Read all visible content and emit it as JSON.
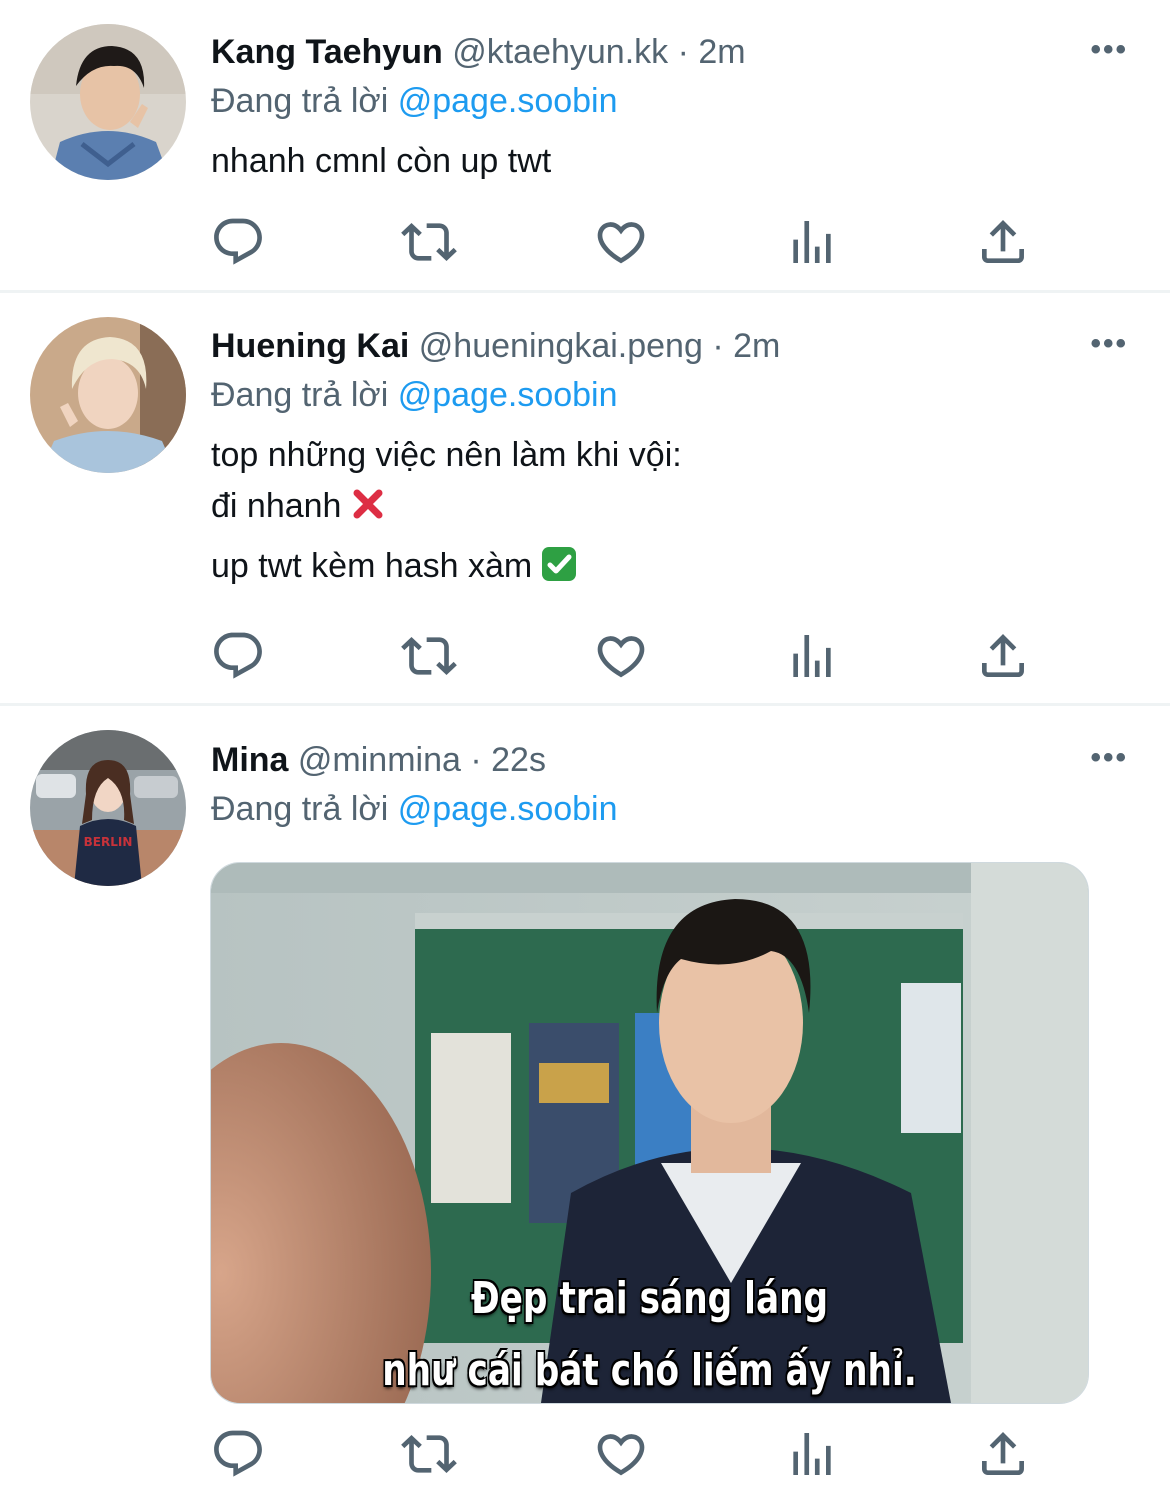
{
  "reply_prefix": "Đang trả lời",
  "colors": {
    "accent": "#1d9bf0",
    "secondary_text": "#536471",
    "primary_text": "#0f1419",
    "divider": "#eff3f4"
  },
  "tweets": [
    {
      "name": "Kang Taehyun",
      "handle": "@ktaehyun.kk",
      "dot": "·",
      "time": "2m",
      "reply_to": "@page.soobin",
      "lines": [
        "nhanh cmnl còn up twt"
      ],
      "more": "•••"
    },
    {
      "name": "Huening Kai",
      "handle": "@hueningkai.peng",
      "dot": "·",
      "time": "2m",
      "reply_to": "@page.soobin",
      "lines": [
        "top những việc nên làm khi vội:",
        "đi nhanh",
        "up twt kèm hash xàm"
      ],
      "more": "•••"
    },
    {
      "name": "Mina",
      "handle": "@minmina",
      "dot": "·",
      "time": "22s",
      "reply_to": "@page.soobin",
      "media_caption": [
        "Đẹp trai sáng láng",
        "như cái bát chó liếm ấy nhỉ."
      ],
      "more": "•••"
    }
  ],
  "action_icons": [
    "reply-icon",
    "retweet-icon",
    "like-icon",
    "views-icon",
    "share-icon"
  ]
}
